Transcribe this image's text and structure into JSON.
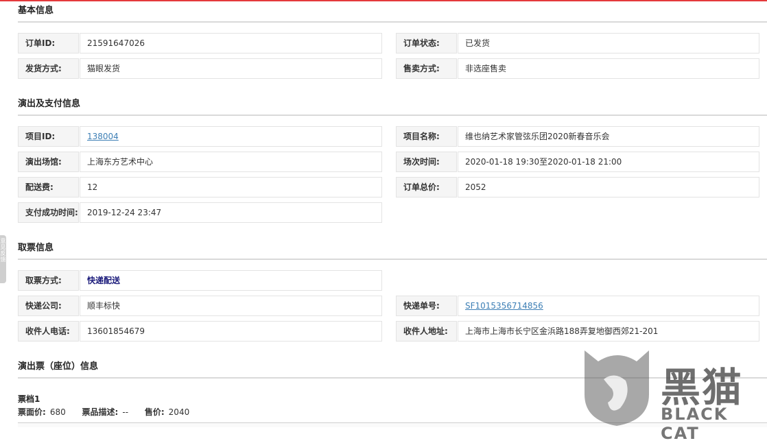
{
  "sections": {
    "basic": "基本信息",
    "show_payment": "演出及支付信息",
    "pickup": "取票信息",
    "seats": "演出票（座位）信息"
  },
  "basic": {
    "order_id": {
      "label": "订单ID:",
      "value": "21591647026"
    },
    "order_status": {
      "label": "订单状态:",
      "value": "已发货"
    },
    "ship_method": {
      "label": "发货方式:",
      "value": "猫眼发货"
    },
    "sale_method": {
      "label": "售卖方式:",
      "value": "非选座售卖"
    }
  },
  "show": {
    "project_id": {
      "label": "项目ID:",
      "value": "138004"
    },
    "project_name": {
      "label": "项目名称:",
      "value": "维也纳艺术家管弦乐团2020新春音乐会"
    },
    "venue": {
      "label": "演出场馆:",
      "value": "上海东方艺术中心"
    },
    "session_time": {
      "label": "场次时间:",
      "value": "2020-01-18 19:30至2020-01-18 21:00"
    },
    "delivery_fee": {
      "label": "配送费:",
      "value": "12"
    },
    "order_total": {
      "label": "订单总价:",
      "value": "2052"
    },
    "paid_time": {
      "label": "支付成功时间:",
      "value": "2019-12-24 23:47"
    }
  },
  "pickup": {
    "pickup_method": {
      "label": "取票方式:",
      "value": "快递配送"
    },
    "courier": {
      "label": "快递公司:",
      "value": "顺丰标快"
    },
    "tracking_no": {
      "label": "快递单号:",
      "value": "SF1015356714856"
    },
    "phone": {
      "label": "收件人电话:",
      "value": "13601854679"
    },
    "address": {
      "label": "收件人地址:",
      "value": "上海市上海市长宁区金浜路188弄复地御西郊21-201"
    }
  },
  "ticket": {
    "name": "票档1",
    "face_label": "票面价:",
    "face_value": "680",
    "desc_label": "票品描述:",
    "desc_value": "--",
    "price_label": "售价:",
    "price_value": "2040"
  },
  "side_tab": "意见反馈",
  "watermark": {
    "title": "黑猫",
    "subtitle": "BLACK CAT"
  },
  "colors": {
    "accent": "#e4393c",
    "link": "#3d7fb5",
    "label_bg": "#f5f5f5"
  }
}
